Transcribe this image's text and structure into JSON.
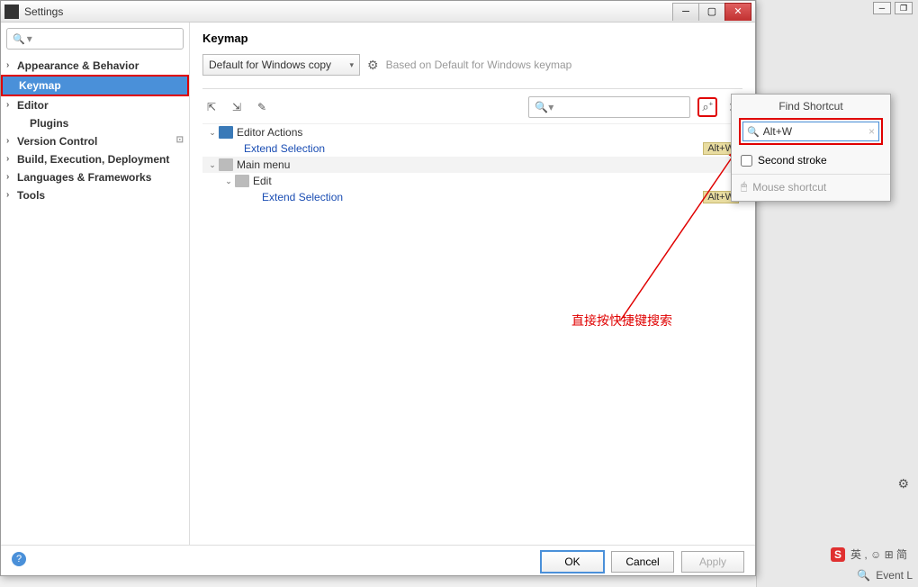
{
  "window": {
    "title": "Settings"
  },
  "sidebar": {
    "search_placeholder": "",
    "items": [
      {
        "label": "Appearance & Behavior",
        "expandable": true
      },
      {
        "label": "Keymap"
      },
      {
        "label": "Editor",
        "expandable": true
      },
      {
        "label": "Plugins",
        "indent": true
      },
      {
        "label": "Version Control",
        "expandable": true,
        "tag": "⊡"
      },
      {
        "label": "Build, Execution, Deployment",
        "expandable": true
      },
      {
        "label": "Languages & Frameworks",
        "expandable": true
      },
      {
        "label": "Tools",
        "expandable": true
      }
    ]
  },
  "main": {
    "title": "Keymap",
    "dropdown": "Default for Windows copy",
    "based": "Based on Default for Windows keymap",
    "tree": {
      "editor_actions": "Editor Actions",
      "extend_selection": "Extend Selection",
      "shortcut": "Alt+W",
      "main_menu": "Main menu",
      "edit": "Edit"
    }
  },
  "popup": {
    "title": "Find Shortcut",
    "value": "Alt+W",
    "second_stroke": "Second stroke",
    "mouse": "Mouse shortcut"
  },
  "buttons": {
    "ok": "OK",
    "cancel": "Cancel",
    "apply": "Apply"
  },
  "annotation": "直接按快捷键搜索",
  "status": {
    "event": "Event L",
    "ime": "英 , ☺ ⊞ 简"
  }
}
